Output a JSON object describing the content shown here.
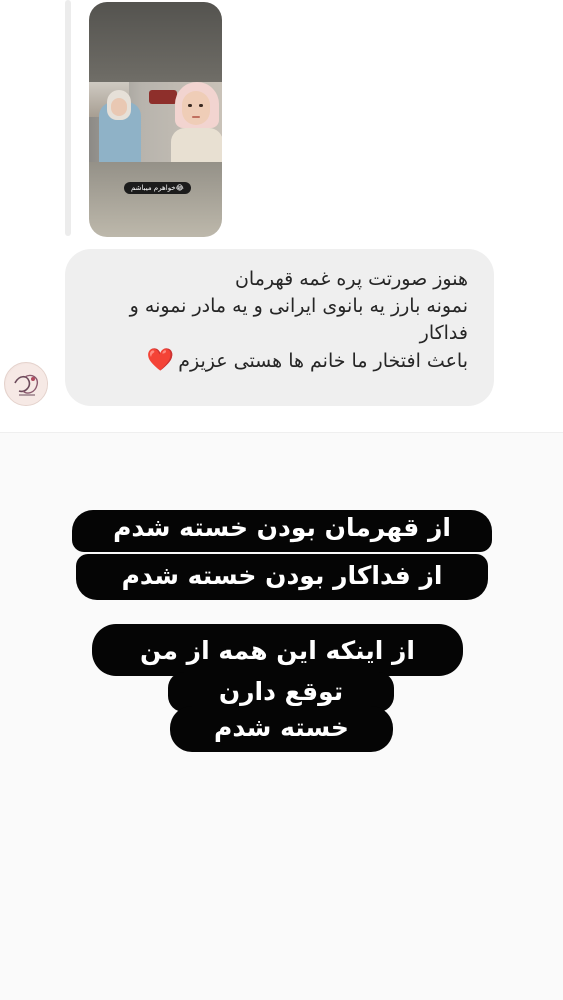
{
  "story_reply": {
    "caption": "خواهرم میباشم😂"
  },
  "comment": {
    "line1": "هنوز صورتت پره غمه قهرمان",
    "line2": "نمونه بارز یه بانوی ایرانی و یه مادر نمونه و",
    "line3": "فداکار",
    "line4": "باعث افتخار ما خانم ها هستی عزیزم",
    "heart": "❤️"
  },
  "story_text": {
    "block1": [
      "از قهرمان بودن خسته شدم",
      "از فداکار بودن خسته شدم"
    ],
    "block2": [
      "از اینکه این همه از من",
      "توقع دارن",
      "خسته شدم"
    ]
  },
  "colors": {
    "bubble": "#efefef",
    "pill": "#050505",
    "heart": "#e0252b"
  }
}
